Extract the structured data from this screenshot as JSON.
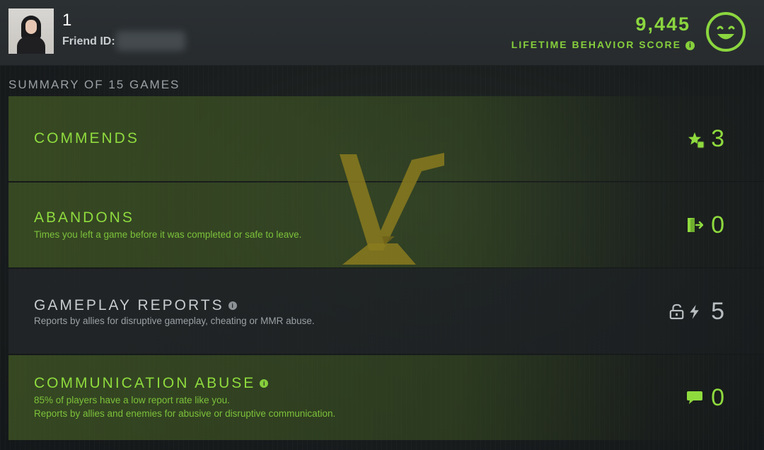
{
  "header": {
    "player_name": "1",
    "friend_id_label": "Friend ID:",
    "score_value": "9,445",
    "score_label": "LIFETIME BEHAVIOR SCORE",
    "info_glyph": "i",
    "smiley_icon": "smiley-face-icon"
  },
  "summary": {
    "title": "SUMMARY OF 15 GAMES"
  },
  "rows": [
    {
      "title": "COMMENDS",
      "description": "",
      "value": "3",
      "icon": "star-thumbs-up-icon",
      "style": "green"
    },
    {
      "title": "ABANDONS",
      "description": "Times you left a game before it was completed or safe to leave.",
      "value": "0",
      "icon": "exit-door-icon",
      "style": "green"
    },
    {
      "title": "GAMEPLAY REPORTS",
      "description": "Reports by allies for disruptive gameplay, cheating or MMR abuse.",
      "value": "5",
      "icon": "unlock-lightning-icon",
      "style": "gray"
    },
    {
      "title": "COMMUNICATION ABUSE",
      "description_1": "85% of players have a low report rate like you.",
      "description_2": "Reports by allies and enemies for abusive or disruptive communication.",
      "value": "0",
      "icon": "chat-bubble-icon",
      "style": "green"
    }
  ],
  "colors": {
    "accent_green": "#8fdb3e",
    "gray_text": "#c8cccf",
    "emblem_gold": "#8a7a1e"
  }
}
